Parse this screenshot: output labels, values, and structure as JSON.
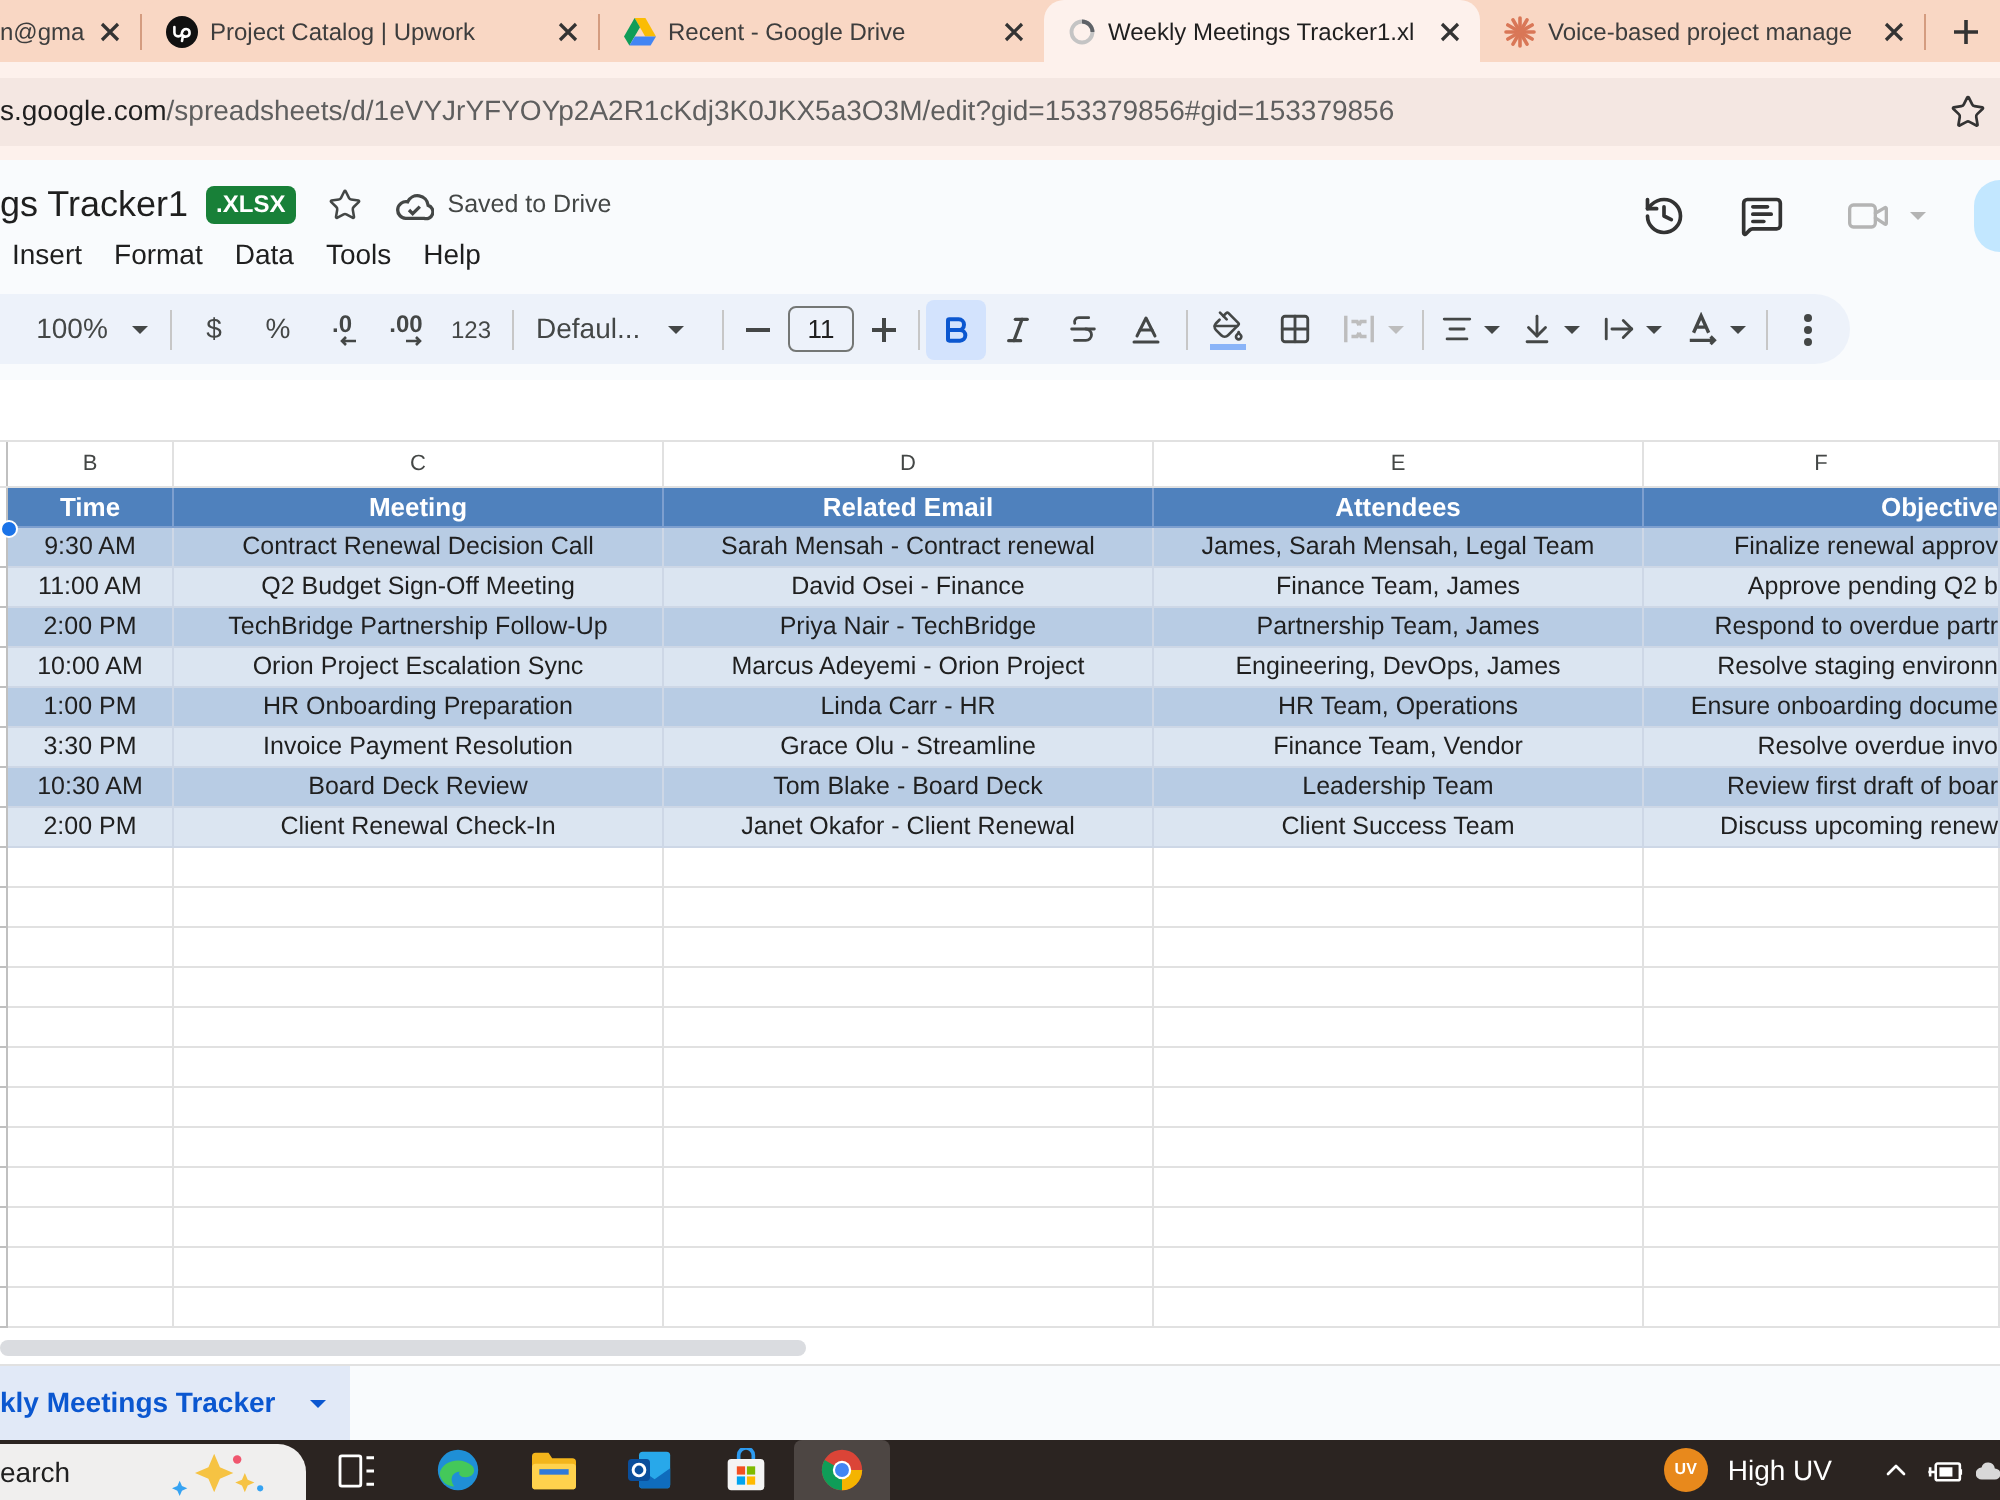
{
  "browser": {
    "tabs": [
      {
        "title": "n@gma",
        "selected": false
      },
      {
        "title": "Project Catalog | Upwork",
        "selected": false
      },
      {
        "title": "Recent - Google Drive",
        "selected": false
      },
      {
        "title": "Weekly Meetings Tracker1.xl",
        "selected": true
      },
      {
        "title": "Voice-based project manage",
        "selected": false
      }
    ],
    "address": {
      "host": "s.google.com",
      "path": "/spreadsheets/d/1eVYJrYFYOYp2A2R1cKdj3K0JKX5a3O3M/edit?gid=153379856#gid=153379856"
    }
  },
  "document": {
    "title": "gs Tracker1",
    "badge": ".XLSX",
    "save_status": "Saved to Drive",
    "menu": [
      "Insert",
      "Format",
      "Data",
      "Tools",
      "Help"
    ],
    "video_call_disabled": true
  },
  "toolbar": {
    "zoom": "100%",
    "currency": "$",
    "percent": "%",
    "decrease_decimal": ".0",
    "increase_decimal": ".00",
    "number_format": "123",
    "font": "Defaul...",
    "font_size": "11",
    "bold": true,
    "merge_disabled": true
  },
  "sheet": {
    "columns": [
      "B",
      "C",
      "D",
      "E",
      "F"
    ],
    "header": [
      "Time",
      "Meeting",
      "Related Email",
      "Attendees",
      "Objective"
    ],
    "rows": [
      [
        "9:30 AM",
        "Contract Renewal Decision Call",
        "Sarah Mensah - Contract renewal",
        "James, Sarah Mensah, Legal Team",
        "Finalize renewal approv"
      ],
      [
        "11:00 AM",
        "Q2 Budget Sign-Off Meeting",
        "David Osei - Finance",
        "Finance Team, James",
        "Approve pending Q2 b"
      ],
      [
        "2:00 PM",
        "TechBridge Partnership Follow-Up",
        "Priya Nair - TechBridge",
        "Partnership Team, James",
        "Respond to overdue partr"
      ],
      [
        "10:00 AM",
        "Orion Project Escalation Sync",
        "Marcus Adeyemi - Orion Project",
        "Engineering, DevOps, James",
        "Resolve staging environn"
      ],
      [
        "1:00 PM",
        "HR Onboarding Preparation",
        "Linda Carr - HR",
        "HR Team, Operations",
        "Ensure onboarding docume"
      ],
      [
        "3:30 PM",
        "Invoice Payment Resolution",
        "Grace Olu - Streamline",
        "Finance Team, Vendor",
        "Resolve overdue invo"
      ],
      [
        "10:30 AM",
        "Board Deck Review",
        "Tom Blake - Board Deck",
        "Leadership Team",
        "Review first draft of boar"
      ],
      [
        "2:00 PM",
        "Client Renewal Check-In",
        "Janet Okafor - Client Renewal",
        "Client Success Team",
        "Discuss upcoming renew"
      ]
    ]
  },
  "sheet_tabs": [
    {
      "label": "kly Meetings Tracker",
      "selected": true
    }
  ],
  "taskbar": {
    "search": {
      "placeholder": "earch"
    },
    "apps": [
      {
        "selected": false
      },
      {
        "selected": false
      },
      {
        "selected": false
      },
      {
        "selected": false
      },
      {
        "selected": true
      }
    ],
    "weather_badge": "UV",
    "weather": "High UV"
  }
}
